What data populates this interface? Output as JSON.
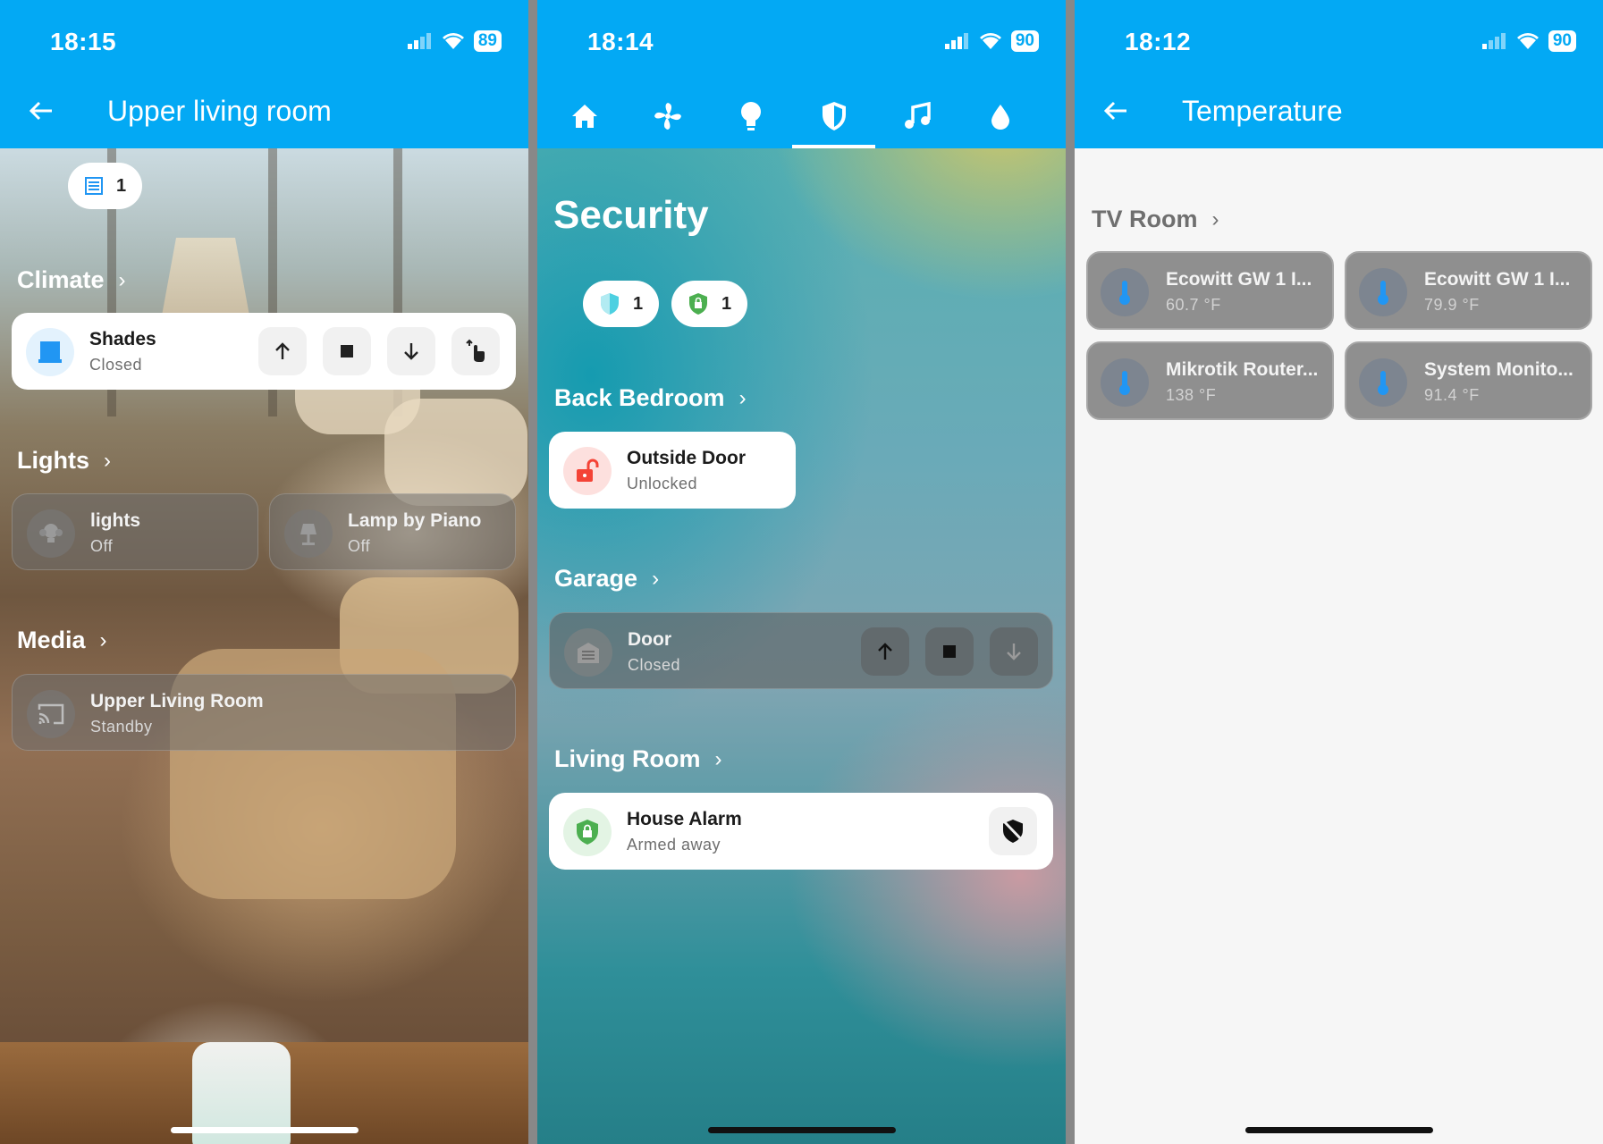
{
  "colors": {
    "accent": "#03a9f4",
    "card_on": "#ffffff",
    "shades_icon": "#2196f3",
    "lock_red": "#f44336",
    "alarm_green": "#4caf50"
  },
  "panel1": {
    "status": {
      "time": "18:15",
      "battery": "89"
    },
    "title": "Upper living room",
    "chip_count": "1",
    "sections": {
      "climate": "Climate",
      "lights": "Lights",
      "media": "Media"
    },
    "shades": {
      "name": "Shades",
      "state": "Closed",
      "icon": "window-shade-icon"
    },
    "lights": [
      {
        "name": "lights",
        "state": "Off",
        "icon": "lightbulb-group-icon"
      },
      {
        "name": "Lamp by Piano",
        "state": "Off",
        "icon": "floor-lamp-icon"
      }
    ],
    "media": {
      "name": "Upper Living Room",
      "state": "Standby",
      "icon": "cast-icon"
    }
  },
  "panel2": {
    "status": {
      "time": "18:14",
      "battery": "90"
    },
    "tabs": [
      "home-icon",
      "fan-icon",
      "lightbulb-icon",
      "shield-icon",
      "music-icon",
      "water-drop-icon"
    ],
    "title": "Security",
    "chips": [
      {
        "count": "1",
        "icon": "shield-half-icon"
      },
      {
        "count": "1",
        "icon": "shield-lock-icon"
      }
    ],
    "sections": {
      "back_bedroom": "Back Bedroom",
      "garage": "Garage",
      "living_room": "Living Room"
    },
    "outside_door": {
      "name": "Outside Door",
      "state": "Unlocked",
      "icon": "lock-open-icon"
    },
    "garage_door": {
      "name": "Door",
      "state": "Closed",
      "icon": "garage-icon"
    },
    "house_alarm": {
      "name": "House Alarm",
      "state": "Armed away",
      "icon": "shield-lock-icon"
    }
  },
  "panel3": {
    "status": {
      "time": "18:12",
      "battery": "90"
    },
    "title": "Temperature",
    "section": "TV Room",
    "sensors": [
      {
        "name": "Ecowitt GW 1 I...",
        "value": "60.7 °F"
      },
      {
        "name": "Ecowitt GW 1 I...",
        "value": "79.9 °F"
      },
      {
        "name": "Mikrotik Router...",
        "value": "138 °F"
      },
      {
        "name": "System Monito...",
        "value": "91.4 °F"
      }
    ]
  }
}
